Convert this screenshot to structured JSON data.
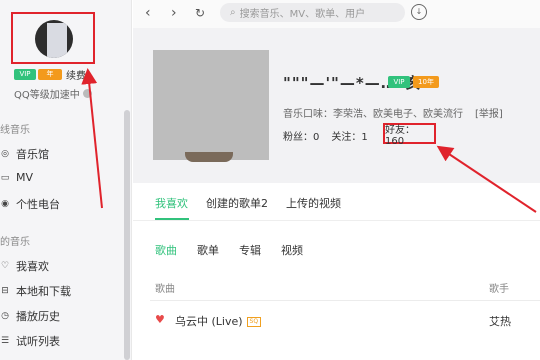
{
  "sidebar": {
    "badge_green": "VIP",
    "badge_orange": "年",
    "renew": "续费",
    "accel_text": "QQ等级加速中",
    "section_online": "线音乐",
    "online_items": [
      {
        "label": "音乐馆",
        "icon": "music-hall-icon"
      },
      {
        "label": "MV",
        "icon": "mv-icon"
      },
      {
        "label": "个性电台",
        "icon": "radio-icon"
      }
    ],
    "section_mine": "的音乐",
    "my_items": [
      {
        "label": "我喜欢",
        "icon": "heart-icon"
      },
      {
        "label": "本地和下载",
        "icon": "download-icon"
      },
      {
        "label": "播放历史",
        "icon": "history-icon"
      },
      {
        "label": "试听列表",
        "icon": "playlist-icon"
      }
    ]
  },
  "topbar": {
    "back": "‹",
    "forward": "›",
    "refresh": "↻",
    "search_placeholder": "搜索音乐、MV、歌单、用户"
  },
  "profile": {
    "username": "\"\"\"—'\"—*—…\"亥",
    "badge_green": "VIP",
    "badge_orange": "10年",
    "taste": "音乐口味：李荣浩、欧美电子、欧美流行",
    "report": "[举报]",
    "fans": "粉丝：0",
    "follows": "关注：1",
    "friends": "好友：160"
  },
  "tabs": [
    "我喜欢",
    "创建的歌单2",
    "上传的视频"
  ],
  "subtabs": [
    "歌曲",
    "歌单",
    "专辑",
    "视频"
  ],
  "table": {
    "col_song": "歌曲",
    "col_artist": "歌手",
    "rows": [
      {
        "title": "乌云中 (Live)",
        "quality": "SQ",
        "artist": "艾热"
      }
    ]
  },
  "colors": {
    "accent": "#31c27c",
    "annotation": "#e0232c"
  }
}
